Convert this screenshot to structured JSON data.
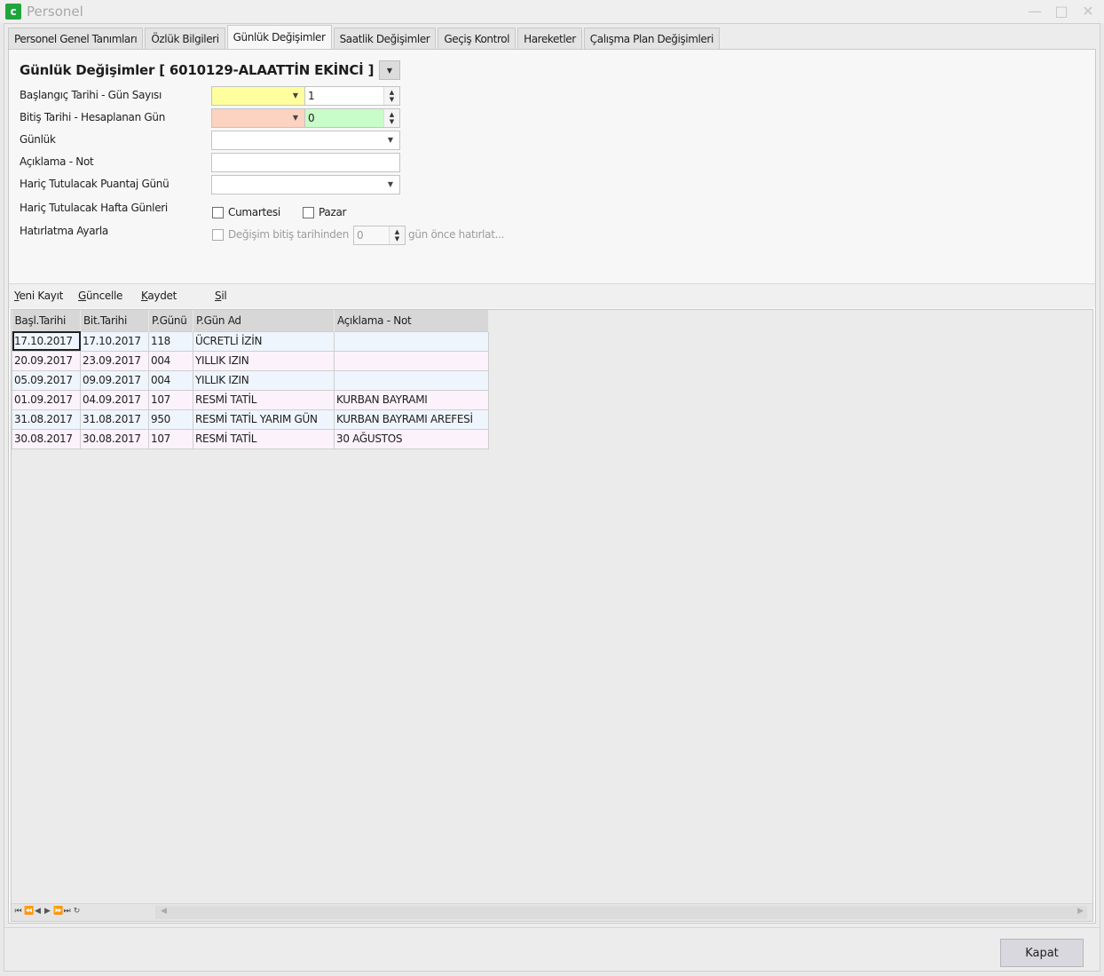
{
  "window": {
    "title": "Personel",
    "icon_letter": "c"
  },
  "tabs": [
    {
      "label": "Personel Genel Tanımları"
    },
    {
      "label": "Özlük Bilgileri"
    },
    {
      "label": "Günlük Değişimler"
    },
    {
      "label": "Saatlik Değişimler"
    },
    {
      "label": "Geçiş Kontrol"
    },
    {
      "label": "Hareketler"
    },
    {
      "label": "Çalışma Plan Değişimleri"
    }
  ],
  "active_tab": "Günlük Değişimler",
  "form": {
    "title": "Günlük Değişimler [ 6010129-ALAATTİN EKİNCİ ]",
    "labels": {
      "start": "Başlangıç Tarihi - Gün Sayısı",
      "end": "Bitiş Tarihi - Hesaplanan Gün",
      "daily": "Günlük",
      "note": "Açıklama - Not",
      "excluded_day": "Hariç Tutulacak Puantaj Günü",
      "excluded_weekdays": "Hariç Tutulacak Hafta Günleri",
      "reminder": "Hatırlatma Ayarla"
    },
    "start_date": "",
    "day_count": "1",
    "end_date": "",
    "computed_days": "0",
    "daily_value": "",
    "note_value": "",
    "excluded_day_value": "",
    "saturday": "Cumartesi",
    "sunday": "Pazar",
    "reminder_prefix": "Değişim bitiş tarihinden",
    "reminder_value": "0",
    "reminder_suffix": "gün önce hatırlat...",
    "colors": {
      "start_bg": "#ffff9e",
      "end_bg": "#fcd2c0",
      "computed_bg": "#c8fcc8"
    }
  },
  "toolbar": {
    "new": {
      "key": "Y",
      "rest": "eni Kayıt"
    },
    "update": {
      "key": "G",
      "rest": "üncelle"
    },
    "save": {
      "key": "K",
      "rest": "aydet"
    },
    "delete": {
      "key": "S",
      "rest": "il"
    }
  },
  "grid": {
    "columns": [
      "Başl.Tarihi",
      "Bit.Tarihi",
      "P.Günü",
      "P.Gün Ad",
      "Açıklama - Not"
    ],
    "rows": [
      [
        "17.10.2017",
        "17.10.2017",
        "118",
        "ÜCRETLİ İZİN",
        ""
      ],
      [
        "20.09.2017",
        "23.09.2017",
        "004",
        "YILLIK IZIN",
        ""
      ],
      [
        "05.09.2017",
        "09.09.2017",
        "004",
        "YILLIK IZIN",
        ""
      ],
      [
        "01.09.2017",
        "04.09.2017",
        "107",
        "RESMİ TATİL",
        "KURBAN BAYRAMI"
      ],
      [
        "31.08.2017",
        "31.08.2017",
        "950",
        "RESMİ TATİL YARIM GÜN",
        "KURBAN BAYRAMI AREFESİ"
      ],
      [
        "30.08.2017",
        "30.08.2017",
        "107",
        "RESMİ TATİL",
        "30 AĞUSTOS"
      ]
    ]
  },
  "footer": {
    "close_label": "Kapat"
  }
}
